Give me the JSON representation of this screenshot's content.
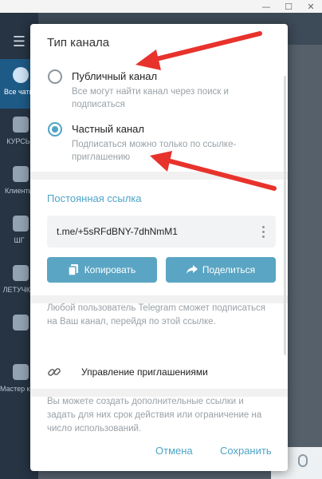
{
  "window": {
    "minimize": "—",
    "maximize": "☐",
    "close": "✕"
  },
  "sidebar": {
    "items": [
      {
        "label": "Все чаты"
      },
      {
        "label": "КУРСЫ"
      },
      {
        "label": "Клиенты"
      },
      {
        "label": "ШГ"
      },
      {
        "label": "ЛЕТУЧКИ"
      },
      {
        "label": ""
      },
      {
        "label": "Мастер клас"
      }
    ]
  },
  "dialog": {
    "title": "Тип канала",
    "options": [
      {
        "label": "Публичный канал",
        "description": "Все могут найти канал через поиск и подписаться",
        "selected": false
      },
      {
        "label": "Частный канал",
        "description": "Подписаться можно только по ссылке-приглашению",
        "selected": true
      }
    ],
    "permanent_link_label": "Постоянная ссылка",
    "link": "t.me/+5sRFdBNY-7dhNmM1",
    "copy_button": "Копировать",
    "share_button": "Поделиться",
    "link_note": "Любой пользователь Telegram сможет подписаться на Ваш канал, перейдя по этой ссылке.",
    "manage_invites": "Управление приглашениями",
    "invites_note": "Вы можете создать дополнительные ссылки и задать для них срок действия или ограничение на число использований.",
    "cancel": "Отмена",
    "save": "Сохранить"
  },
  "colors": {
    "accent": "#4ea4c7",
    "button": "#5aa5c3",
    "arrow": "#e8322c"
  },
  "icons": [
    "menu-icon",
    "copy-icon",
    "share-icon",
    "link-icon",
    "more-vertical-icon",
    "microphone-icon"
  ]
}
